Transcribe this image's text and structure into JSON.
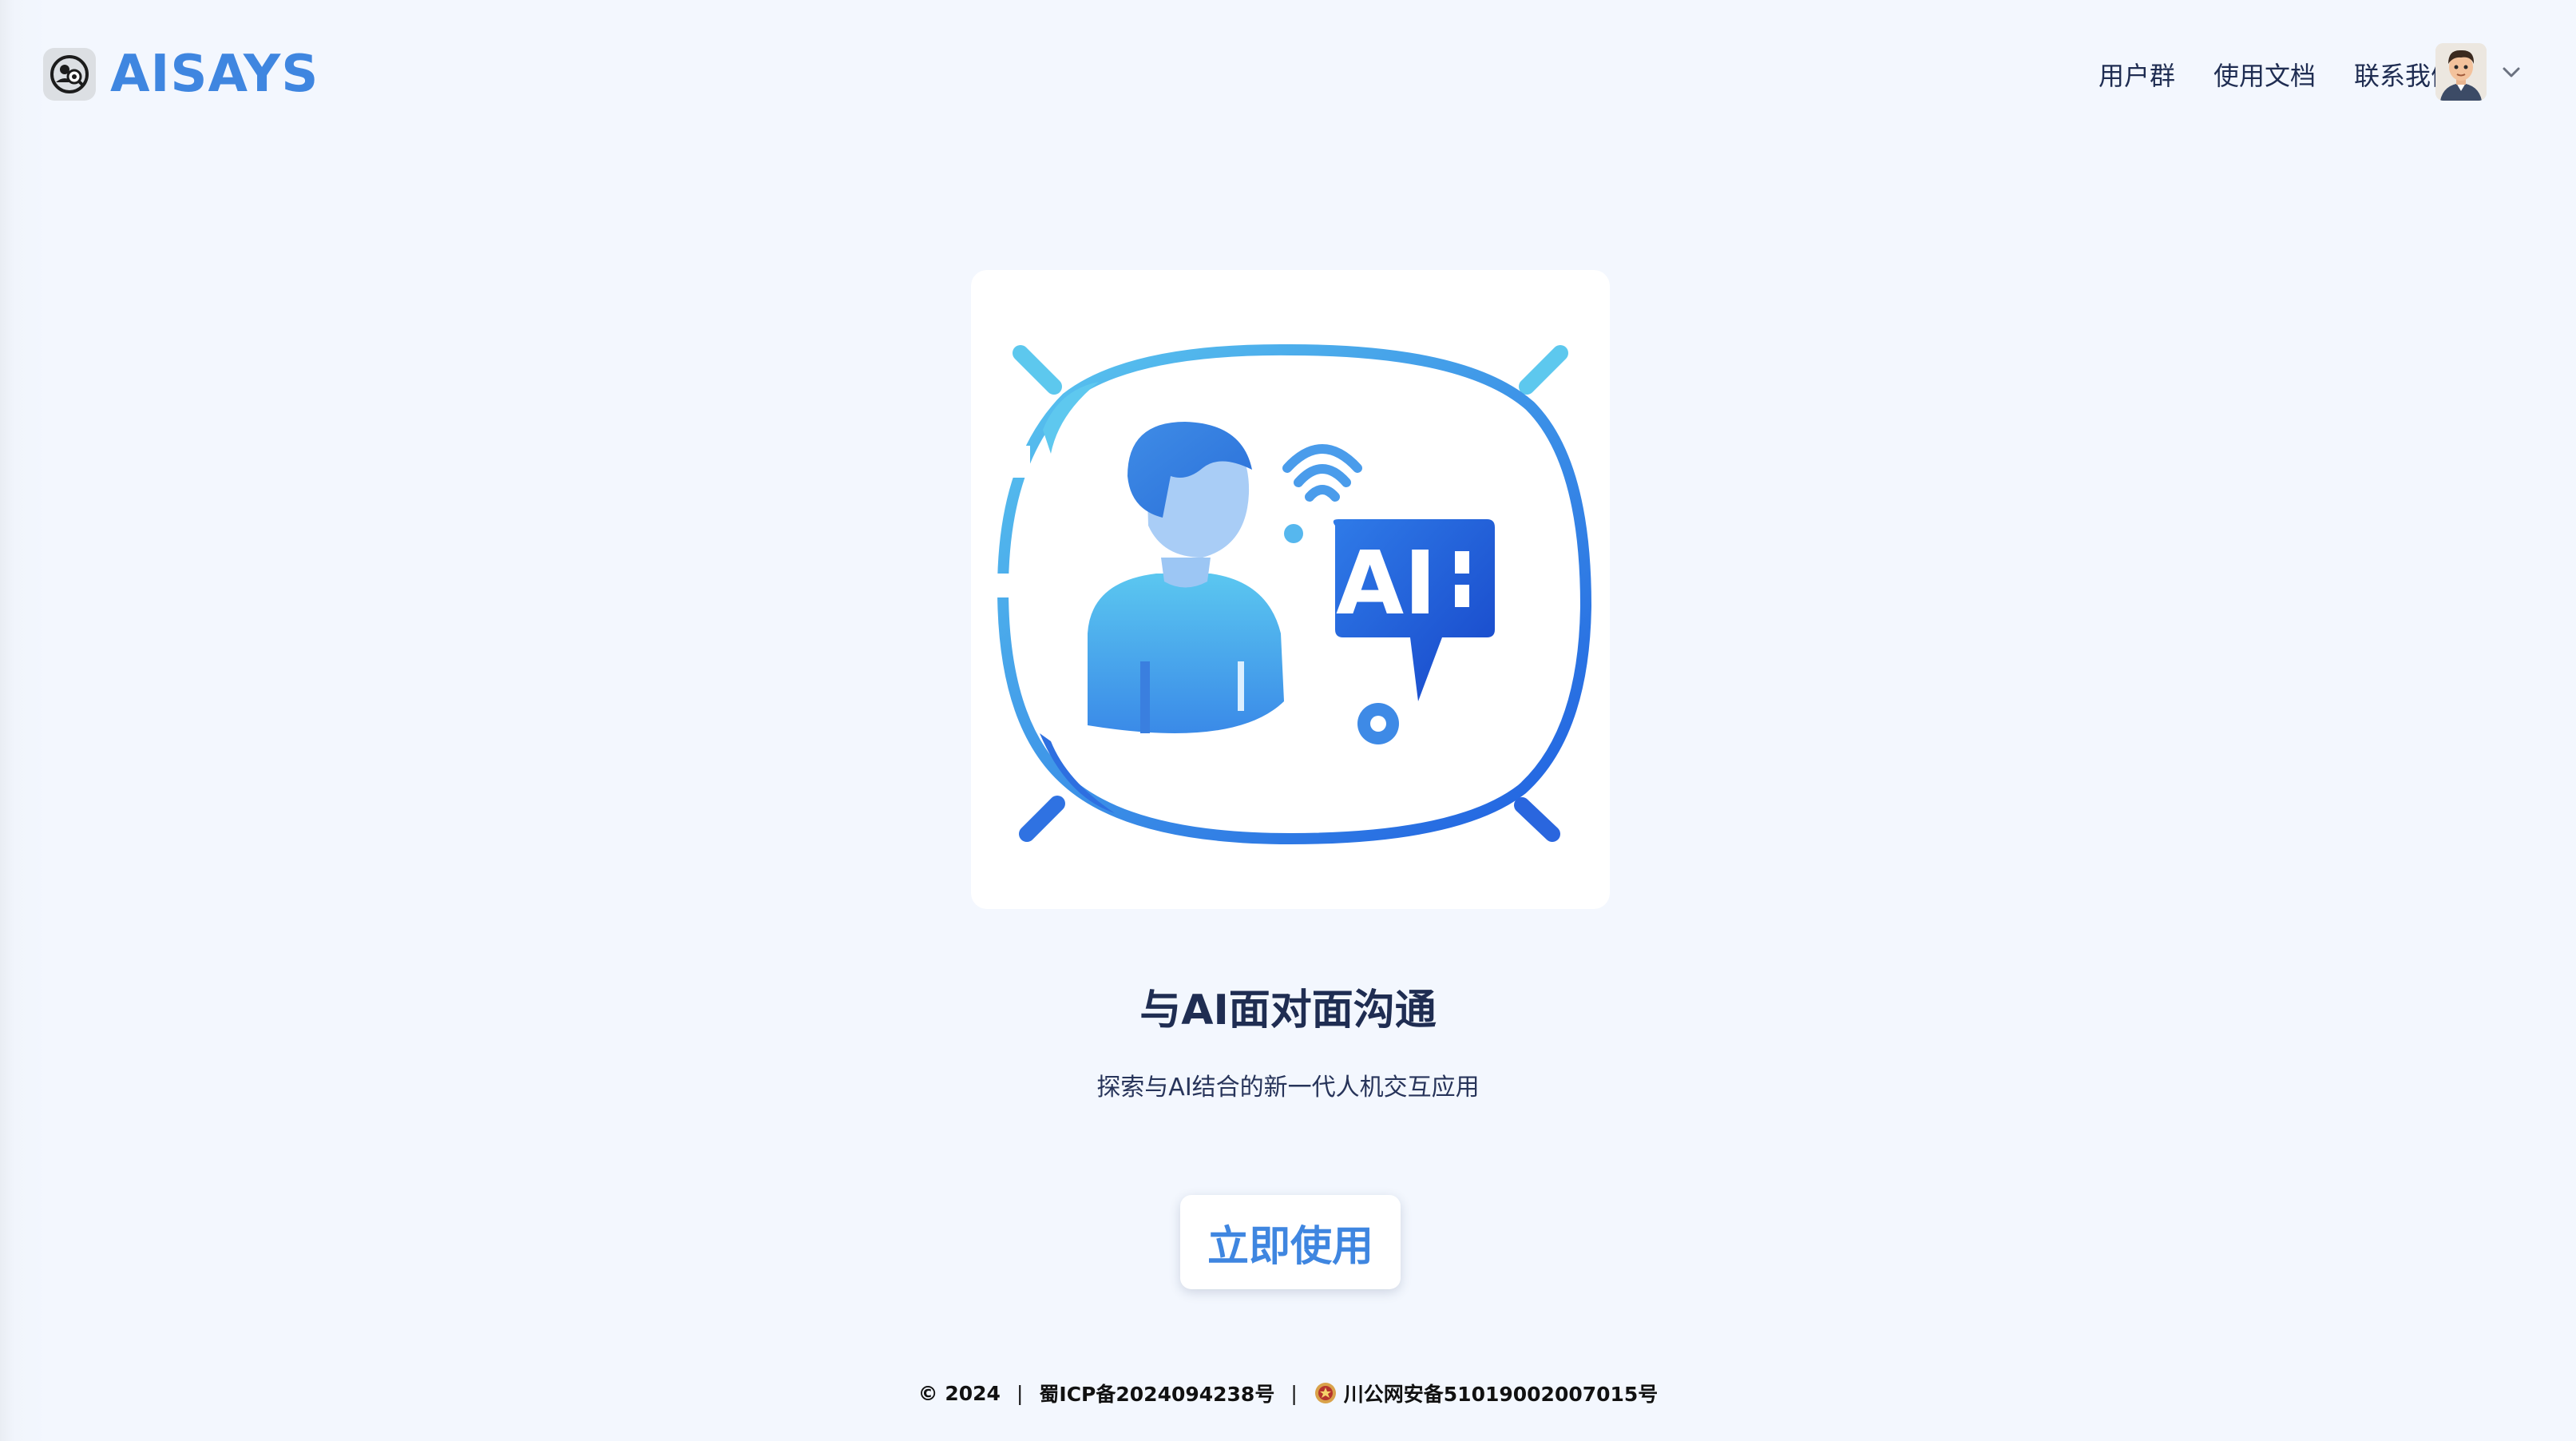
{
  "header": {
    "logo_text": "AISAYS",
    "nav": [
      {
        "label": "用户群"
      },
      {
        "label": "使用文档"
      },
      {
        "label": "联系我们"
      }
    ]
  },
  "hero": {
    "illustration_icon": "ai-chat-illustration-icon",
    "illustration_text": "AI",
    "title": "与AI面对面沟通",
    "subtitle": "探索与AI结合的新一代人机交互应用",
    "cta_label": "立即使用"
  },
  "footer": {
    "copyright": "© 2024",
    "icp": "蜀ICP备2024094238号",
    "police": "川公网安备51019002007015号"
  },
  "colors": {
    "brand": "#3f86e0",
    "background": "#f3f7fe",
    "text": "#1f2d52"
  }
}
